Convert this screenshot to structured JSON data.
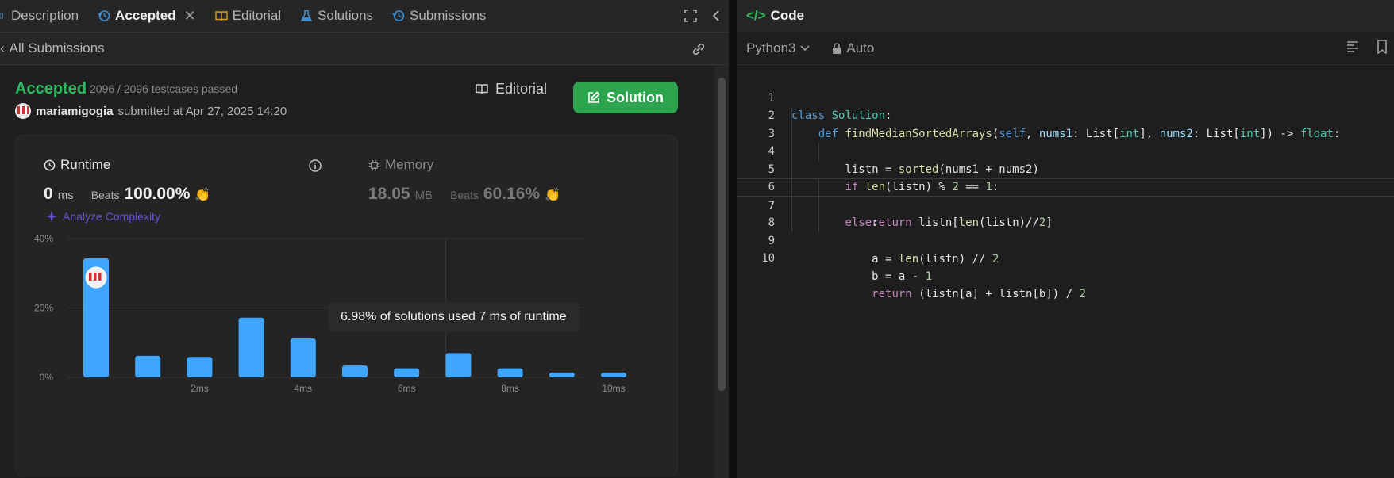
{
  "tabs": [
    {
      "label": "Description",
      "icon": "document-icon"
    },
    {
      "label": "Accepted",
      "icon": "history-icon",
      "active": true
    },
    {
      "label": "Editorial",
      "icon": "book-icon"
    },
    {
      "label": "Solutions",
      "icon": "flask-icon"
    },
    {
      "label": "Submissions",
      "icon": "history-icon"
    }
  ],
  "subheader": {
    "back_label": "All Submissions"
  },
  "result": {
    "status": "Accepted",
    "testcases": "2096 / 2096 testcases passed",
    "username": "mariamigogia",
    "submitted_text": "submitted at Apr 27, 2025 14:20",
    "editorial_button": "Editorial",
    "solution_button": "Solution"
  },
  "runtime": {
    "title": "Runtime",
    "value": "0",
    "unit": "ms",
    "beats_label": "Beats",
    "beats_value": "100.00%",
    "analyze_label": "Analyze Complexity"
  },
  "memory": {
    "title": "Memory",
    "value": "18.05",
    "unit": "MB",
    "beats_label": "Beats",
    "beats_value": "60.16%"
  },
  "tooltip": "6.98% of solutions used 7 ms of runtime",
  "chart_data": {
    "type": "bar",
    "categories": [
      "0ms",
      "1ms",
      "2ms",
      "3ms",
      "4ms",
      "5ms",
      "6ms",
      "7ms",
      "8ms",
      "9ms",
      "10ms"
    ],
    "values": [
      34.3,
      6.2,
      5.9,
      17.2,
      11.2,
      3.4,
      2.6,
      7.0,
      2.6,
      1.4,
      1.4
    ],
    "y_ticks": [
      "0%",
      "20%",
      "40%"
    ],
    "x_tick_labels": [
      "2ms",
      "4ms",
      "6ms",
      "8ms",
      "10ms"
    ],
    "ylim": [
      0,
      40
    ],
    "bar_color": "#3ea6ff",
    "grid": true
  },
  "code": {
    "header": "Code",
    "language": "Python3",
    "mode": "Auto",
    "lines": [
      "class Solution:",
      "    def findMedianSortedArrays(self, nums1: List[int], nums2: List[int]) -> float:",
      "        listn = sorted(nums1 + nums2)",
      "        if len(listn) % 2 == 1:",
      "            return listn[len(listn)//2]",
      "        else:",
      "            a = len(listn) // 2",
      "            b = a - 1",
      "            return (listn[a] + listn[b]) / 2",
      ""
    ]
  },
  "colors": {
    "accent_green": "#2cbb5d",
    "button_green": "#2da44e",
    "bar_blue": "#3ea6ff"
  }
}
